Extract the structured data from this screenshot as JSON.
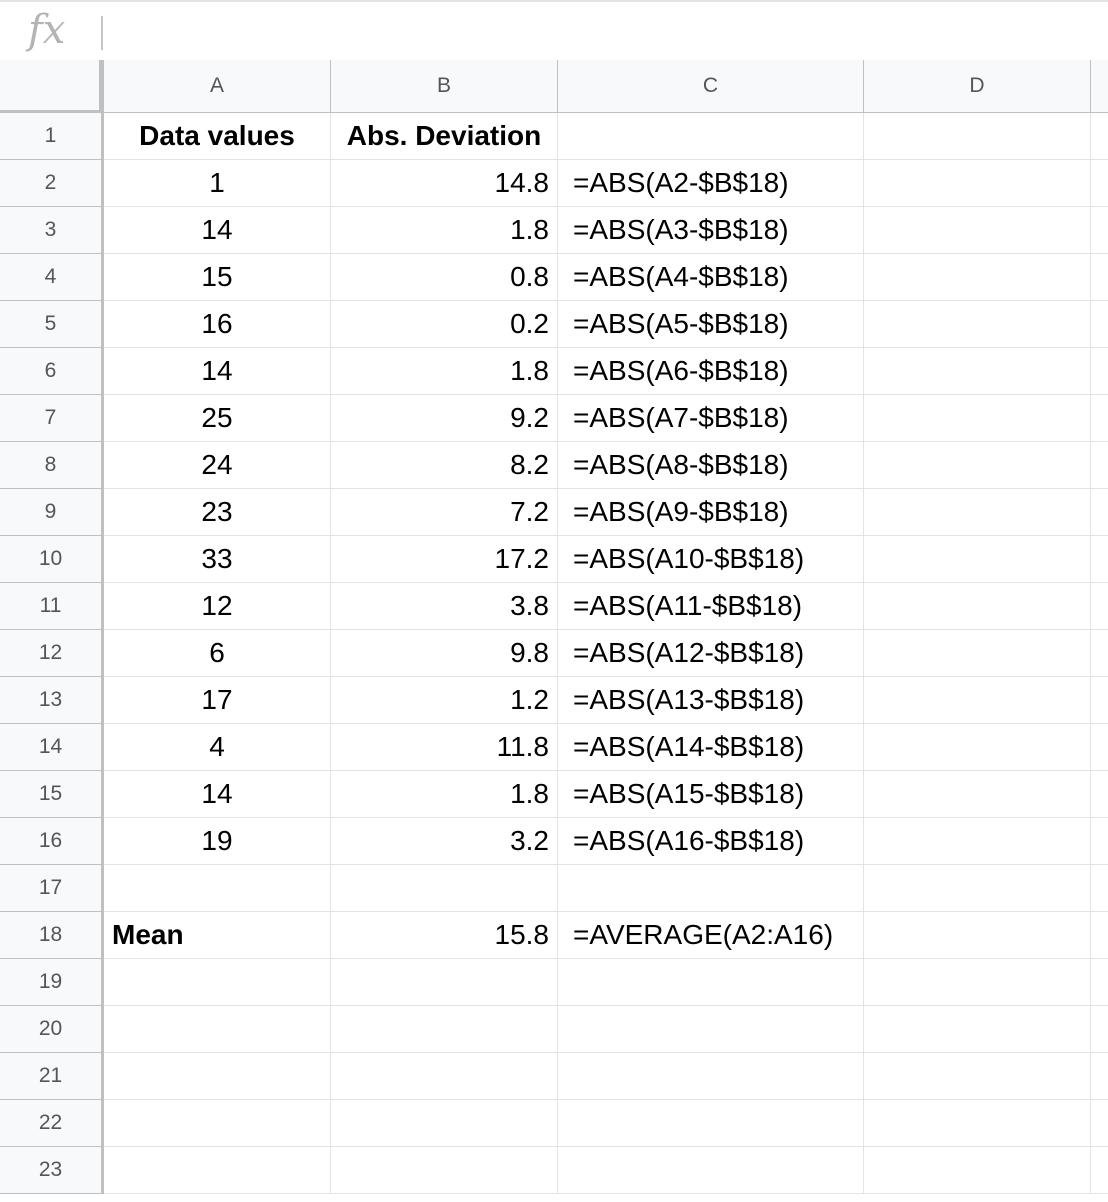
{
  "formula_bar": {
    "icon": "fx-icon",
    "fx_label": "fx",
    "value": ""
  },
  "columns": [
    "A",
    "B",
    "C",
    "D"
  ],
  "rows": [
    {
      "num": "1",
      "a": "Data values",
      "b": "Abs. Deviation",
      "c": ""
    },
    {
      "num": "2",
      "a": "1",
      "b": "14.8",
      "c": "=ABS(A2-$B$18)"
    },
    {
      "num": "3",
      "a": "14",
      "b": "1.8",
      "c": "=ABS(A3-$B$18)"
    },
    {
      "num": "4",
      "a": "15",
      "b": "0.8",
      "c": "=ABS(A4-$B$18)"
    },
    {
      "num": "5",
      "a": "16",
      "b": "0.2",
      "c": "=ABS(A5-$B$18)"
    },
    {
      "num": "6",
      "a": "14",
      "b": "1.8",
      "c": "=ABS(A6-$B$18)"
    },
    {
      "num": "7",
      "a": "25",
      "b": "9.2",
      "c": "=ABS(A7-$B$18)"
    },
    {
      "num": "8",
      "a": "24",
      "b": "8.2",
      "c": "=ABS(A8-$B$18)"
    },
    {
      "num": "9",
      "a": "23",
      "b": "7.2",
      "c": "=ABS(A9-$B$18)"
    },
    {
      "num": "10",
      "a": "33",
      "b": "17.2",
      "c": "=ABS(A10-$B$18)"
    },
    {
      "num": "11",
      "a": "12",
      "b": "3.8",
      "c": "=ABS(A11-$B$18)"
    },
    {
      "num": "12",
      "a": "6",
      "b": "9.8",
      "c": "=ABS(A12-$B$18)"
    },
    {
      "num": "13",
      "a": "17",
      "b": "1.2",
      "c": "=ABS(A13-$B$18)"
    },
    {
      "num": "14",
      "a": "4",
      "b": "11.8",
      "c": "=ABS(A14-$B$18)"
    },
    {
      "num": "15",
      "a": "14",
      "b": "1.8",
      "c": "=ABS(A15-$B$18)"
    },
    {
      "num": "16",
      "a": "19",
      "b": "3.2",
      "c": "=ABS(A16-$B$18)"
    },
    {
      "num": "17",
      "a": "",
      "b": "",
      "c": ""
    },
    {
      "num": "18",
      "a": "Mean",
      "b": "15.8",
      "c": "=AVERAGE(A2:A16)"
    },
    {
      "num": "19",
      "a": "",
      "b": "",
      "c": ""
    },
    {
      "num": "20",
      "a": "",
      "b": "",
      "c": ""
    },
    {
      "num": "21",
      "a": "",
      "b": "",
      "c": ""
    },
    {
      "num": "22",
      "a": "",
      "b": "",
      "c": ""
    },
    {
      "num": "23",
      "a": "",
      "b": "",
      "c": ""
    }
  ]
}
